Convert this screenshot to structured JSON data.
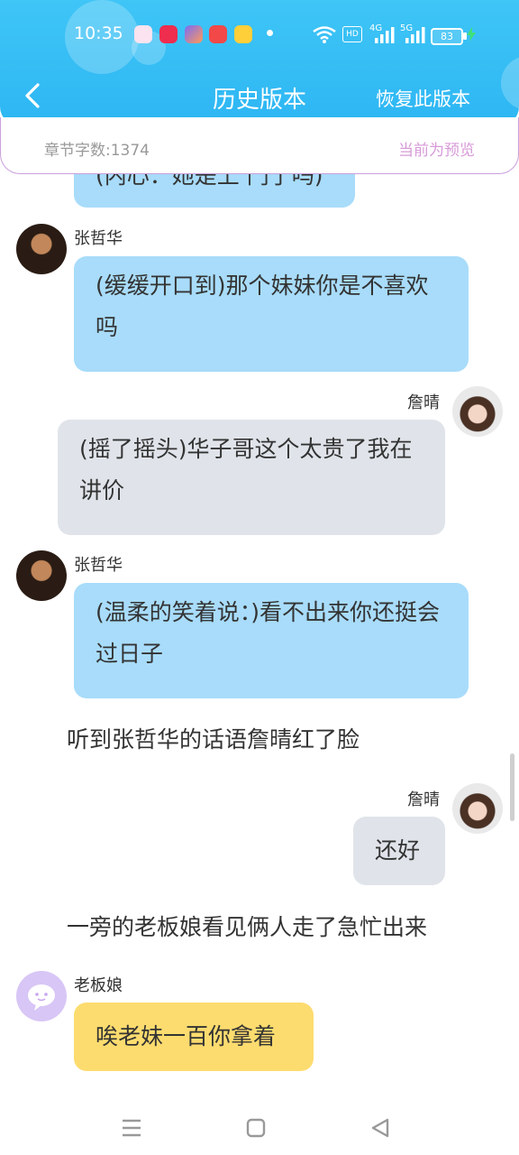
{
  "status_bar": {
    "time": "10:35",
    "signal_label_1": "4G",
    "signal_label_2": "5G",
    "battery": "83"
  },
  "nav": {
    "title": "历史版本",
    "restore_label": "恢复此版本"
  },
  "info_bar": {
    "word_count": "章节字数:1374",
    "preview_label": "当前为预览"
  },
  "conversation": {
    "top_partial_text": "(内心：她是上 门了吗)",
    "messages": [
      {
        "speaker": "张哲华",
        "text": "(缓缓开口到)那个妹妹你是不喜欢吗"
      },
      {
        "speaker": "詹晴",
        "text": "(摇了摇头)华子哥这个太贵了我在讲价"
      },
      {
        "speaker": "张哲华",
        "text": "(温柔的笑着说：)看不出来你还挺会过日子"
      },
      {
        "speaker": "詹晴",
        "text": "还好"
      },
      {
        "speaker": "老板娘",
        "text": "唉老妹一百你拿着"
      }
    ],
    "narrations": [
      "听到张哲华的话语詹晴红了脸",
      "一旁的老板娘看见俩人走了急忙出来"
    ]
  },
  "colors": {
    "header": "#2db6f3",
    "bubble_blue": "#a8dcfa",
    "bubble_grey": "#e0e4ea",
    "bubble_yellow": "#fddc6f",
    "preview": "#d79ad8"
  }
}
